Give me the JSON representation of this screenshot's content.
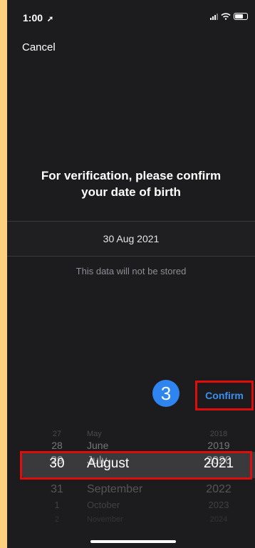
{
  "status_bar": {
    "time": "1:00",
    "location_icon": "location-arrow-icon"
  },
  "nav": {
    "cancel_label": "Cancel"
  },
  "prompt": {
    "line1": "For verification, please confirm",
    "line2": "your date of birth"
  },
  "selected_date": "30 Aug 2021",
  "note": "This data will not be stored",
  "annotation": {
    "step_number": "3"
  },
  "confirm_label": "Confirm",
  "picker": {
    "rows": [
      {
        "day": "27",
        "month": "May",
        "year": "2018"
      },
      {
        "day": "28",
        "month": "June",
        "year": "2019"
      },
      {
        "day": "29",
        "month": "July",
        "year": "2020"
      },
      {
        "day": "30",
        "month": "August",
        "year": "2021",
        "selected": true
      },
      {
        "day": "31",
        "month": "September",
        "year": "2022"
      },
      {
        "day": "1",
        "month": "October",
        "year": "2023"
      },
      {
        "day": "2",
        "month": "November",
        "year": "2024"
      }
    ]
  },
  "colors": {
    "accent": "#3b8ff2",
    "annotation_red": "#e00d0d",
    "badge_blue": "#2f85f0",
    "page_bg": "#fbd07e"
  }
}
